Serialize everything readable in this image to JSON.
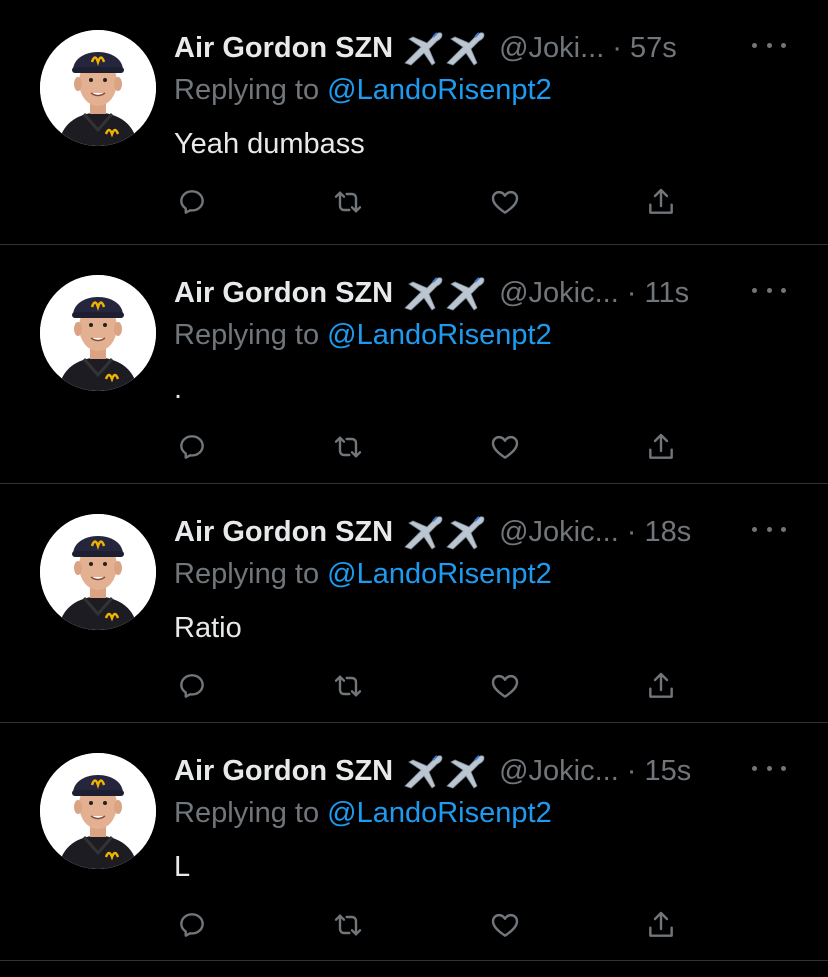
{
  "colors": {
    "background": "#000000",
    "text": "#e7e9ea",
    "secondary": "#71767b",
    "link": "#1d9bf0",
    "divider": "#2f3336"
  },
  "tweets": [
    {
      "name": "Air Gordon SZN",
      "emoji": "✈️✈️",
      "handle": "@Joki...",
      "time": "· 57s",
      "replying_prefix": "Replying to",
      "replying_handle": "@LandoRisenpt2",
      "text": "Yeah dumbass"
    },
    {
      "name": "Air Gordon SZN",
      "emoji": "✈️✈️",
      "handle": "@Jokic...",
      "time": "· 11s",
      "replying_prefix": "Replying to",
      "replying_handle": "@LandoRisenpt2",
      "text": "."
    },
    {
      "name": "Air Gordon SZN",
      "emoji": "✈️✈️",
      "handle": "@Jokic...",
      "time": "· 18s",
      "replying_prefix": "Replying to",
      "replying_handle": "@LandoRisenpt2",
      "text": "Ratio"
    },
    {
      "name": "Air Gordon SZN",
      "emoji": "✈️✈️",
      "handle": "@Jokic...",
      "time": "· 15s",
      "replying_prefix": "Replying to",
      "replying_handle": "@LandoRisenpt2",
      "text": "L"
    }
  ],
  "icons": {
    "reply": "reply-icon",
    "retweet": "retweet-icon",
    "like": "like-icon",
    "share": "share-icon",
    "more": "more-icon"
  }
}
